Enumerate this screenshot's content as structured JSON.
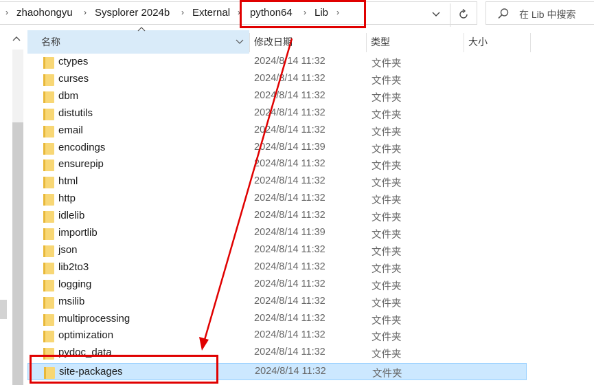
{
  "breadcrumb": {
    "items": [
      "zhaohongyu",
      "Sysplorer 2024b",
      "External",
      "python64",
      "Lib"
    ],
    "separator": "›"
  },
  "toolbar": {
    "dropdown_icon": "chevron-down-icon",
    "refresh_icon": "refresh-icon"
  },
  "search": {
    "placeholder": "在 Lib 中搜索"
  },
  "columns": {
    "name": "名称",
    "date": "修改日期",
    "type": "类型",
    "size": "大小"
  },
  "files": [
    {
      "name": "ctypes",
      "date": "2024/8/14 11:32",
      "type": "文件夹"
    },
    {
      "name": "curses",
      "date": "2024/8/14 11:32",
      "type": "文件夹"
    },
    {
      "name": "dbm",
      "date": "2024/8/14 11:32",
      "type": "文件夹"
    },
    {
      "name": "distutils",
      "date": "2024/8/14 11:32",
      "type": "文件夹"
    },
    {
      "name": "email",
      "date": "2024/8/14 11:32",
      "type": "文件夹"
    },
    {
      "name": "encodings",
      "date": "2024/8/14 11:39",
      "type": "文件夹"
    },
    {
      "name": "ensurepip",
      "date": "2024/8/14 11:32",
      "type": "文件夹"
    },
    {
      "name": "html",
      "date": "2024/8/14 11:32",
      "type": "文件夹"
    },
    {
      "name": "http",
      "date": "2024/8/14 11:32",
      "type": "文件夹"
    },
    {
      "name": "idlelib",
      "date": "2024/8/14 11:32",
      "type": "文件夹"
    },
    {
      "name": "importlib",
      "date": "2024/8/14 11:39",
      "type": "文件夹"
    },
    {
      "name": "json",
      "date": "2024/8/14 11:32",
      "type": "文件夹"
    },
    {
      "name": "lib2to3",
      "date": "2024/8/14 11:32",
      "type": "文件夹"
    },
    {
      "name": "logging",
      "date": "2024/8/14 11:32",
      "type": "文件夹"
    },
    {
      "name": "msilib",
      "date": "2024/8/14 11:32",
      "type": "文件夹"
    },
    {
      "name": "multiprocessing",
      "date": "2024/8/14 11:32",
      "type": "文件夹"
    },
    {
      "name": "optimization",
      "date": "2024/8/14 11:32",
      "type": "文件夹"
    },
    {
      "name": "pydoc_data",
      "date": "2024/8/14 11:32",
      "type": "文件夹"
    },
    {
      "name": "site-packages",
      "date": "2024/8/14 11:32",
      "type": "文件夹",
      "selected": true
    }
  ],
  "colors": {
    "annotation": "#e00000",
    "selected_bg": "#cce8ff",
    "header_active_bg": "#d9ebf9",
    "folder_yellow": "#f8d775"
  }
}
